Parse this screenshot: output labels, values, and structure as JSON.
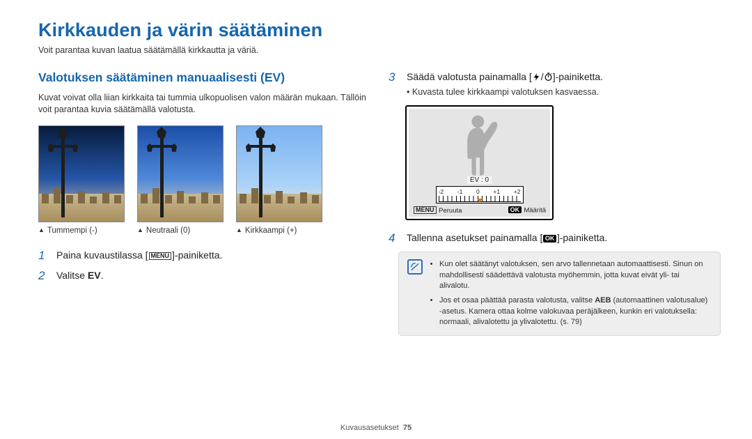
{
  "title": "Kirkkauden ja värin säätäminen",
  "subtitle": "Voit parantaa kuvan laatua säätämällä kirkkautta ja väriä.",
  "left": {
    "section_title": "Valotuksen säätäminen manuaalisesti (EV)",
    "section_para": "Kuvat voivat olla liian kirkkaita tai tummia ulkopuolisen valon määrän mukaan. Tällöin voit parantaa kuvia säätämällä valotusta.",
    "caps": {
      "dark": "Tummempi (-)",
      "mid": "Neutraali (0)",
      "bright": "Kirkkaampi (+)"
    },
    "step1_pre": "Paina kuvaustilassa [",
    "step1_post": "]-painiketta.",
    "step2_pre": "Valitse ",
    "step2_em": "EV",
    "step2_post": "."
  },
  "right": {
    "step3_pre": "Säädä valotusta painamalla [",
    "step3_mid": "/",
    "step3_post": "]-painiketta.",
    "step3_sub": "Kuvasta tulee kirkkaampi valotuksen kasvaessa.",
    "step4_pre": "Tallenna asetukset painamalla [",
    "step4_post": "]-painiketta.",
    "lcd": {
      "ev_label": "EV : 0",
      "ticks": {
        "n2": "-2",
        "n1": "-1",
        "z": "0",
        "p1": "+1",
        "p2": "+2"
      },
      "menu_glyph": "MENU",
      "cancel": "Peruuta",
      "ok_glyph": "OK",
      "set": "Määritä"
    },
    "note1": "Kun olet säätänyt valotuksen, sen arvo tallennetaan automaattisesti. Sinun on mahdollisesti säädettävä valotusta myöhemmin, jotta kuvat eivät yli- tai alivalotu.",
    "note2_pre": "Jos et osaa päättää parasta valotusta, valitse ",
    "note2_em": "AEB",
    "note2_post": " (automaattinen valotusalue) -asetus. Kamera ottaa kolme valokuvaa peräjälkeen, kunkin eri valotuksella: normaali, alivalotettu ja ylivalotettu. (s. 79)"
  },
  "glyphs": {
    "menu": "MENU",
    "ok": "OK"
  },
  "footer": {
    "section": "Kuvausasetukset",
    "page": "75"
  }
}
